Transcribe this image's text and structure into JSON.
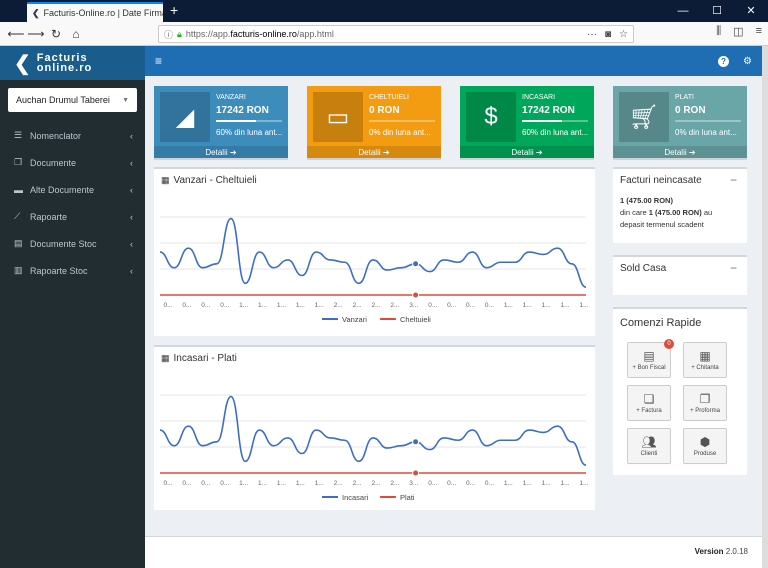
{
  "browser": {
    "tab_title": "Facturis-Online.ro | Date Firma",
    "url_prefix": "https://app.",
    "url_domain": "facturis-online.ro",
    "url_suffix": "/app.html"
  },
  "sidebar": {
    "logo_line1": "Facturis",
    "logo_line2": "online.ro",
    "company": "Auchan Drumul Taberei",
    "items": [
      {
        "label": "Nomenclator",
        "icon": "list-icon"
      },
      {
        "label": "Documente",
        "icon": "copy-icon"
      },
      {
        "label": "Alte Documente",
        "icon": "folder-open-icon"
      },
      {
        "label": "Rapoarte",
        "icon": "line-chart-icon"
      },
      {
        "label": "Documente Stoc",
        "icon": "file-icon"
      },
      {
        "label": "Rapoarte Stoc",
        "icon": "bar-chart-icon"
      }
    ]
  },
  "boxes": [
    {
      "label": "VANZARI",
      "value": "17242 RON",
      "progress_text": "60% din luna ant...",
      "progress": 0.6,
      "details": "Detalii",
      "color": "#3c8dbc",
      "icon": "area-chart-icon"
    },
    {
      "label": "CHELTUIELI",
      "value": "0 RON",
      "progress_text": "0% din luna ant...",
      "progress": 0,
      "details": "Detalii",
      "color": "#f39c12",
      "icon": "credit-card-icon"
    },
    {
      "label": "INCASARI",
      "value": "17242 RON",
      "progress_text": "60% din luna ant...",
      "progress": 0.6,
      "details": "Detalii",
      "color": "#00a65a",
      "icon": "money-icon"
    },
    {
      "label": "PLATI",
      "value": "0 RON",
      "progress_text": "0% din luna ant...",
      "progress": 0,
      "details": "Detalii",
      "color": "#6aa5a8",
      "icon": "cart-icon"
    }
  ],
  "chart1": {
    "title": "Vanzari - Cheltuieli",
    "legend": [
      "Vanzari",
      "Cheltuieli"
    ]
  },
  "chart2": {
    "title": "Incasari - Plati",
    "legend": [
      "Incasari",
      "Plati"
    ]
  },
  "tick_labels": [
    "0...",
    "0...",
    "0...",
    "0...",
    "1...",
    "1...",
    "1...",
    "1...",
    "1...",
    "2...",
    "2...",
    "2...",
    "2...",
    "3...",
    "0...",
    "0...",
    "0...",
    "0...",
    "1...",
    "1...",
    "1...",
    "1...",
    "1..."
  ],
  "chart_data": [
    {
      "type": "line",
      "title": "Vanzari - Cheltuieli",
      "series": [
        {
          "name": "Vanzari",
          "color": "#3c6ec8",
          "values": [
            0.55,
            0.35,
            0.6,
            0.35,
            0.4,
            0.98,
            0.15,
            0.55,
            0.35,
            0.45,
            0.25,
            0.55,
            0.45,
            0.42,
            0.15,
            0.45,
            0.32,
            0.35,
            0.4,
            0.3,
            0.45,
            0.42,
            0.55,
            0.35,
            0.42,
            0.42,
            0.55,
            0.52,
            0.6,
            0.4,
            0.1
          ]
        },
        {
          "name": "Cheltuieli",
          "color": "#dd4b39",
          "values": [
            0,
            0,
            0,
            0,
            0,
            0,
            0,
            0,
            0,
            0,
            0,
            0,
            0,
            0,
            0,
            0,
            0,
            0,
            0,
            0,
            0,
            0,
            0,
            0,
            0,
            0,
            0,
            0,
            0,
            0,
            0
          ]
        }
      ]
    },
    {
      "type": "line",
      "title": "Incasari - Plati",
      "series": [
        {
          "name": "Incasari",
          "color": "#3c6ec8",
          "values": [
            0.55,
            0.35,
            0.6,
            0.35,
            0.4,
            0.98,
            0.15,
            0.55,
            0.35,
            0.45,
            0.25,
            0.55,
            0.45,
            0.42,
            0.15,
            0.45,
            0.32,
            0.35,
            0.4,
            0.3,
            0.45,
            0.42,
            0.55,
            0.35,
            0.42,
            0.42,
            0.55,
            0.52,
            0.6,
            0.4,
            0.1
          ]
        },
        {
          "name": "Plati",
          "color": "#dd4b39",
          "values": [
            0,
            0,
            0,
            0,
            0,
            0,
            0,
            0,
            0,
            0,
            0,
            0,
            0,
            0,
            0,
            0,
            0,
            0,
            0,
            0,
            0,
            0,
            0,
            0,
            0,
            0,
            0,
            0,
            0,
            0,
            0
          ]
        }
      ]
    }
  ],
  "right_panels": {
    "facturi_title": "Facturi neincasate",
    "facturi_line1": "1 (475.00 RON)",
    "facturi_line2a": "din care ",
    "facturi_line2b": "1 (475.00 RON)",
    "facturi_line2c": " au",
    "facturi_line3": "depasit termenul scadent",
    "sold_title": "Sold Casa",
    "comenzi_title": "Comenzi Rapide",
    "buttons": [
      {
        "label": "+ Bon Fiscal",
        "icon": "receipt-icon",
        "badge": "0"
      },
      {
        "label": "+ Chitanta",
        "icon": "calculator-icon"
      },
      {
        "label": "+ Factura",
        "icon": "files-icon"
      },
      {
        "label": "+ Proforma",
        "icon": "copy-icon"
      },
      {
        "label": "Clienti",
        "icon": "users-icon"
      },
      {
        "label": "Produse",
        "icon": "cube-icon"
      }
    ]
  },
  "footer": {
    "version_label": "Version",
    "version": "2.0.18"
  }
}
